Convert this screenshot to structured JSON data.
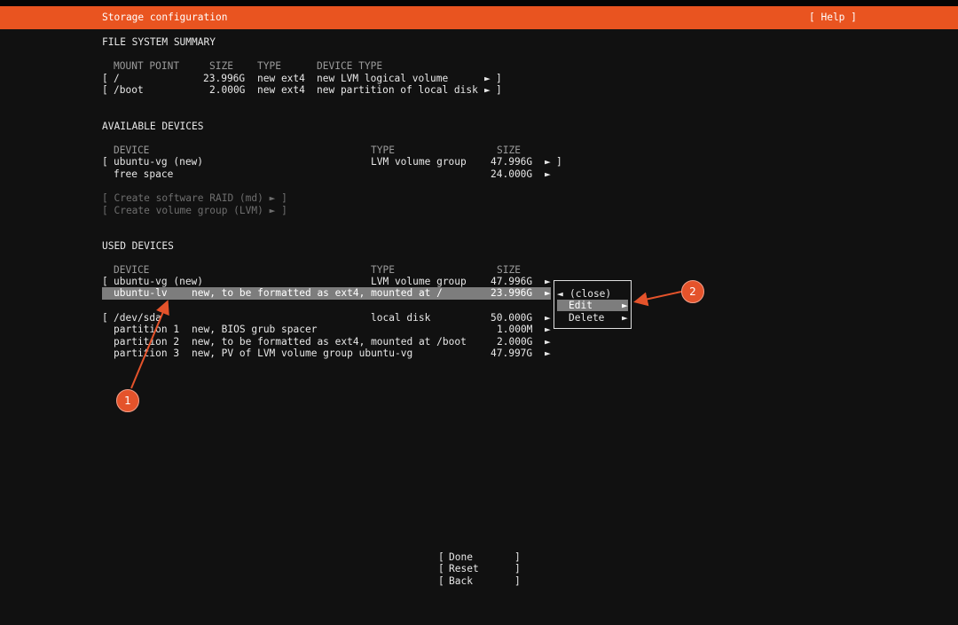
{
  "header": {
    "title": "Storage configuration",
    "help": "[ Help ]"
  },
  "fs_summary": {
    "title": "FILE SYSTEM SUMMARY",
    "columns": [
      "MOUNT POINT",
      "SIZE",
      "TYPE",
      "DEVICE TYPE"
    ],
    "rows": [
      {
        "open": "[",
        "mount": "/",
        "size": "23.996G",
        "type": "new ext4",
        "device_type": "new LVM logical volume",
        "arrow": "►",
        "close": "]"
      },
      {
        "open": "[",
        "mount": "/boot",
        "size": "2.000G",
        "type": "new ext4",
        "device_type": "new partition of local disk",
        "arrow": "►",
        "close": "]"
      }
    ]
  },
  "available": {
    "title": "AVAILABLE DEVICES",
    "columns": [
      "DEVICE",
      "TYPE",
      "SIZE"
    ],
    "rows": [
      {
        "open": "[",
        "device": "ubuntu-vg (new)",
        "type": "LVM volume group",
        "size": "47.996G",
        "arrow": "►",
        "close": "]"
      },
      {
        "open": "",
        "device": "free space",
        "type": "",
        "size": "24.000G",
        "arrow": "►",
        "close": ""
      }
    ],
    "actions": [
      "[ Create software RAID (md) ► ]",
      "[ Create volume group (LVM) ► ]"
    ]
  },
  "used": {
    "title": "USED DEVICES",
    "columns": [
      "DEVICE",
      "TYPE",
      "SIZE"
    ],
    "vg_row": {
      "open": "[",
      "device": "ubuntu-vg (new)",
      "type": "LVM volume group",
      "size": "47.996G",
      "arrow": "►"
    },
    "lv_row": {
      "device": "ubuntu-lv",
      "desc": "new, to be formatted as ext4, mounted at /",
      "size": "23.996G",
      "arrow": "►"
    },
    "disk_row": {
      "open": "[",
      "device": "/dev/sda",
      "type": "local disk",
      "size": "50.000G",
      "arrow": "►"
    },
    "partitions": [
      {
        "name": "partition 1",
        "desc": "new, BIOS grub spacer",
        "size": "1.000M",
        "arrow": "►"
      },
      {
        "name": "partition 2",
        "desc": "new, to be formatted as ext4, mounted at /boot",
        "size": "2.000G",
        "arrow": "►"
      },
      {
        "name": "partition 3",
        "desc": "new, PV of LVM volume group ubuntu-vg",
        "size": "47.997G",
        "arrow": "►"
      }
    ]
  },
  "context_menu": {
    "close": {
      "arrow": "◄",
      "label": "(close)"
    },
    "items": [
      {
        "label": "Edit",
        "arrow": "►"
      },
      {
        "label": "Delete",
        "arrow": "►"
      }
    ]
  },
  "buttons": [
    {
      "open": "[",
      "label": "Done",
      "close": "]"
    },
    {
      "open": "[",
      "label": "Reset",
      "close": "]"
    },
    {
      "open": "[",
      "label": "Back",
      "close": "]"
    }
  ],
  "callouts": [
    "1",
    "2"
  ],
  "colors": {
    "accent": "#e95420",
    "highlight": "#7d7d7d",
    "callout": "#e4532b"
  }
}
